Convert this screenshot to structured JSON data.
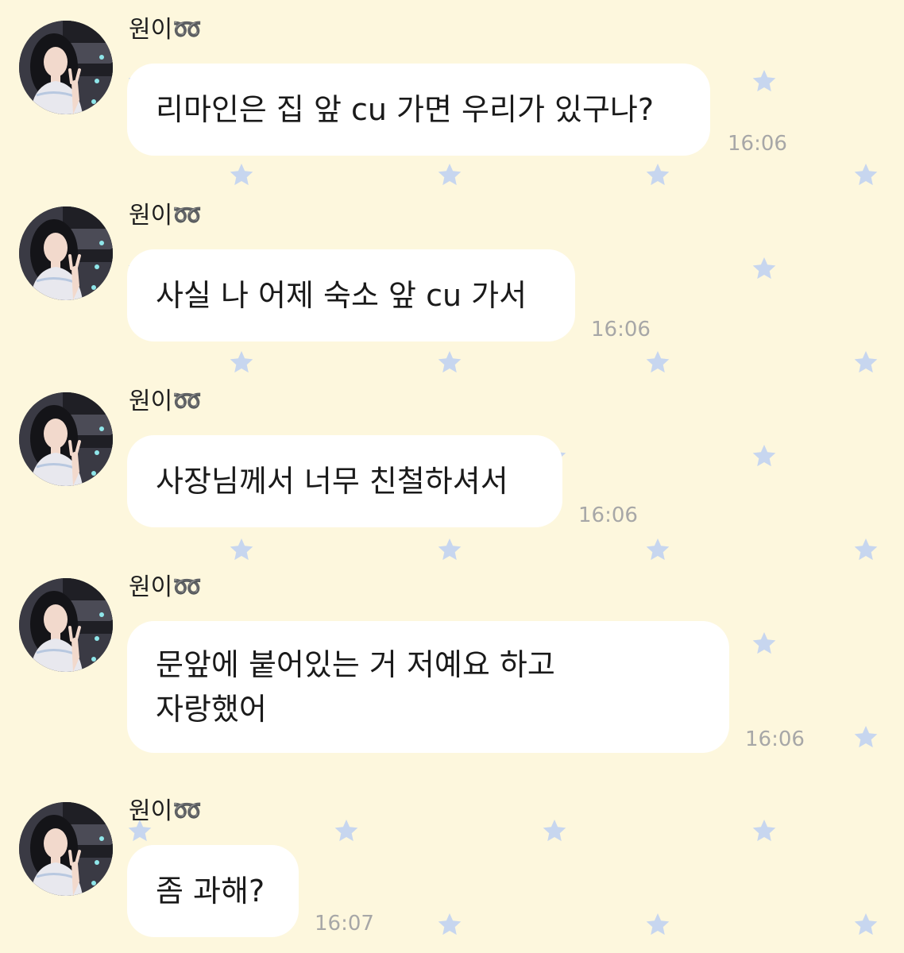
{
  "messages": [
    {
      "sender": "원이➿",
      "text": "리마인은 집 앞 cu 가면 우리가 있구나?",
      "time": "16:06"
    },
    {
      "sender": "원이➿",
      "text": "사실 나 어제 숙소 앞 cu 가서",
      "time": "16:06"
    },
    {
      "sender": "원이➿",
      "text": "사장님께서 너무 친철하셔서",
      "time": "16:06"
    },
    {
      "sender": "원이➿",
      "text": "문앞에 붙어있는 거 저예요 하고\n자랑했어",
      "time": "16:06"
    },
    {
      "sender": "원이➿",
      "text": "좀 과해?",
      "time": "16:07"
    }
  ],
  "colors": {
    "background": "#fdf7dd",
    "bubble": "#ffffff",
    "star": "#c7d6ef",
    "timestamp": "#a7a7a7"
  }
}
